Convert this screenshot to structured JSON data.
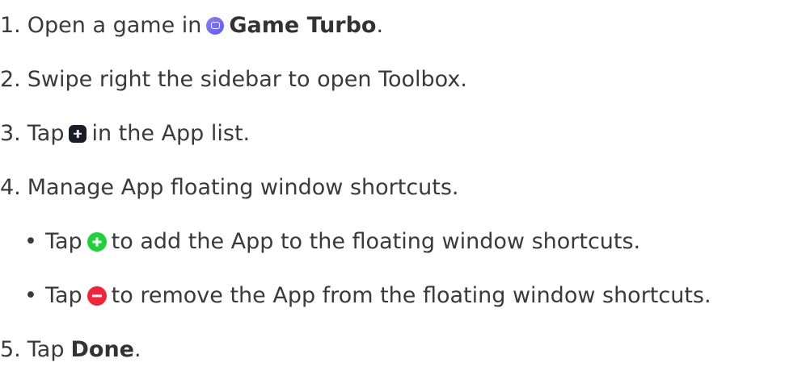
{
  "steps": {
    "s1": {
      "num": "1.",
      "pre": "Open a game in",
      "app": "Game Turbo",
      "post": "."
    },
    "s2": {
      "num": "2.",
      "text": "Swipe right the sidebar to open Toolbox."
    },
    "s3": {
      "num": "3.",
      "pre": "Tap",
      "post": "in the App list."
    },
    "s4": {
      "num": "4.",
      "text": "Manage App floating window shortcuts."
    },
    "s4a": {
      "bullet": "•",
      "pre": "Tap",
      "post": "to add the App to the floating window shortcuts."
    },
    "s4b": {
      "bullet": "•",
      "pre": "Tap",
      "post": "to remove the App from the floating window shortcuts."
    },
    "s5": {
      "num": "5.",
      "pre": "Tap",
      "done": "Done",
      "post": "."
    }
  },
  "icons": {
    "game_turbo": "game-turbo-icon",
    "add_app": "plus-square-icon",
    "add_shortcut": "plus-circle-icon",
    "remove_shortcut": "minus-circle-icon"
  },
  "colors": {
    "game_turbo": "#6f69f6",
    "add_app": "#1c1c28",
    "add_shortcut": "#1fd13a",
    "remove_shortcut": "#f2243a",
    "text": "#3a3a3a"
  }
}
